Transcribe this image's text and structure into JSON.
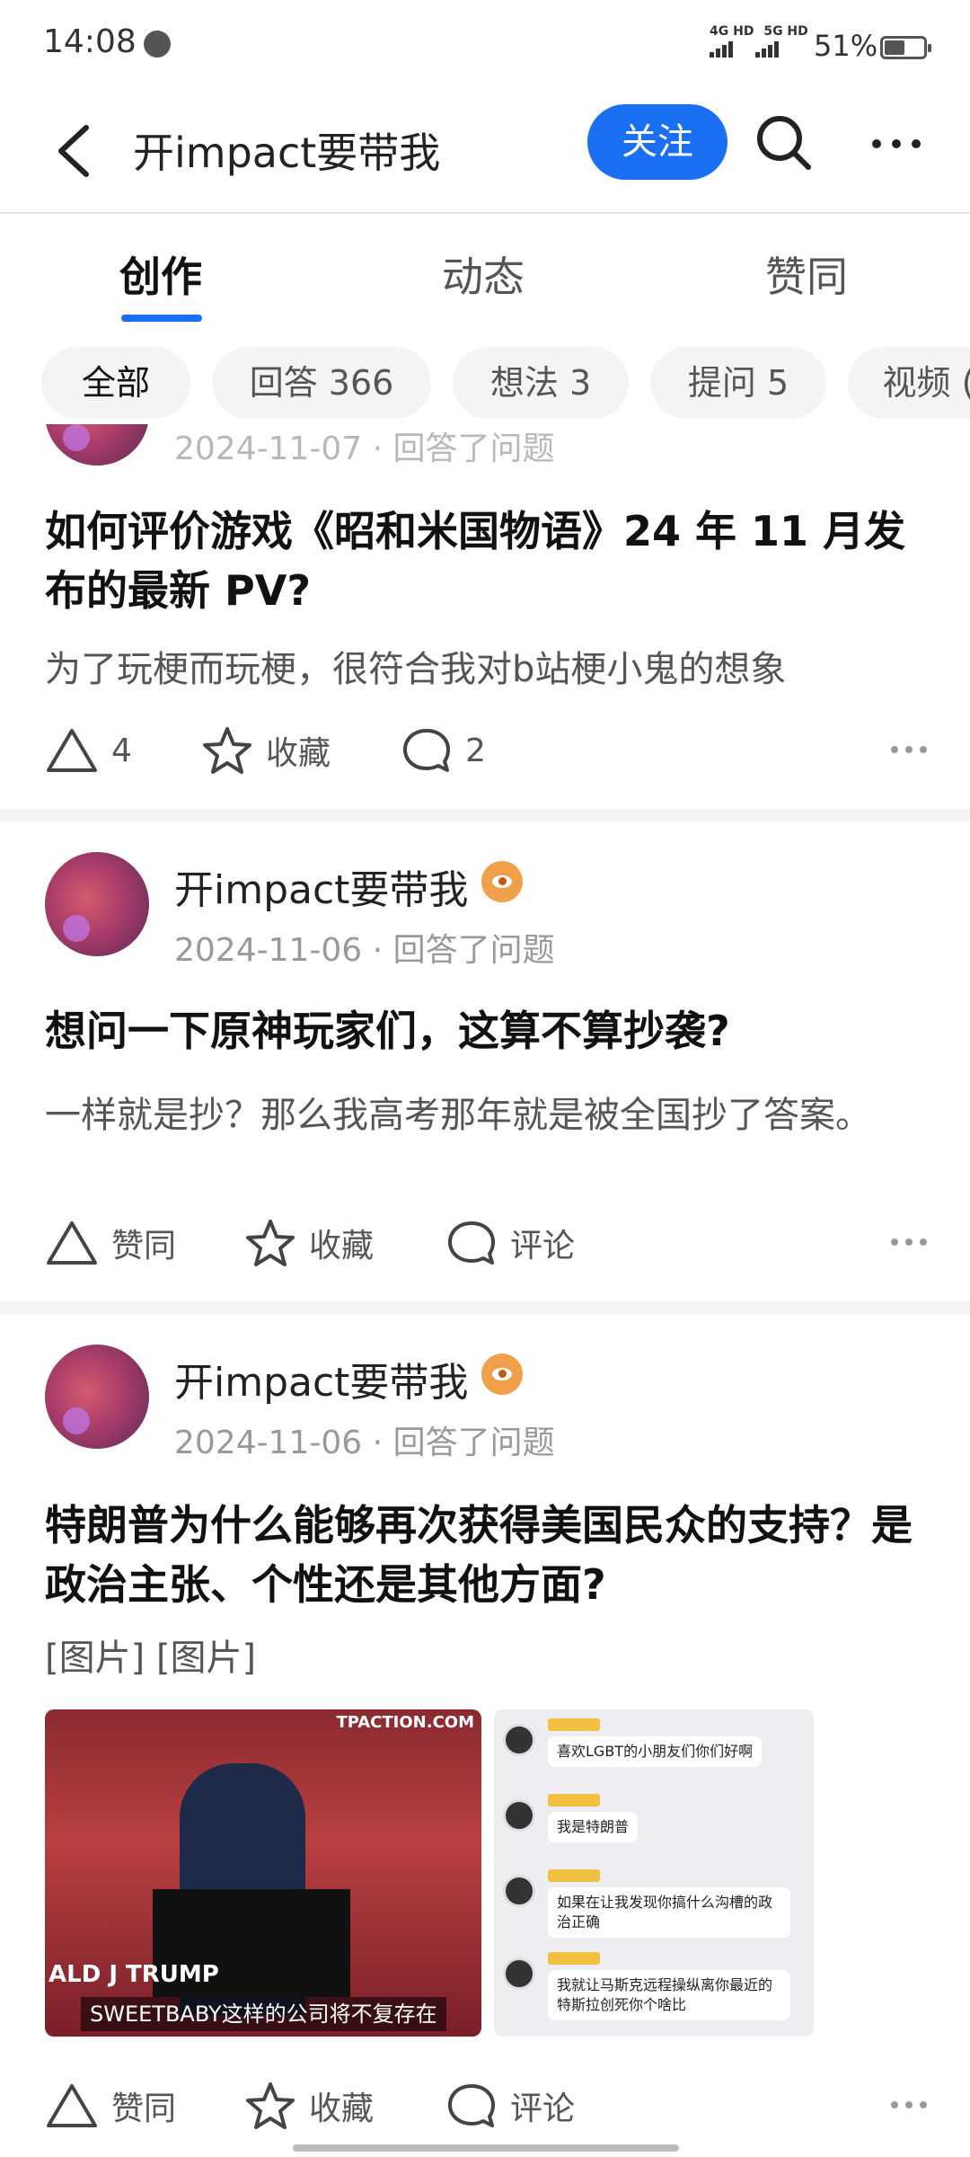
{
  "status_bar": {
    "time": "14:08",
    "network_1": "4G HD",
    "network_2": "5G HD",
    "battery": "51%"
  },
  "header": {
    "title": "开impact要带我",
    "follow_label": "关注",
    "icons": [
      "back-icon",
      "search-icon",
      "more-icon"
    ]
  },
  "tabs": [
    {
      "label": "创作",
      "active": true
    },
    {
      "label": "动态",
      "active": false
    },
    {
      "label": "赞同",
      "active": false
    }
  ],
  "chips": [
    {
      "label": "全部",
      "active": true
    },
    {
      "label": "回答 366"
    },
    {
      "label": "想法 3"
    },
    {
      "label": "提问 5"
    },
    {
      "label": "视频 (",
      "truncated": true
    }
  ],
  "feed": [
    {
      "partial_meta": "2024-11-07 · 回答了问题",
      "title": "如何评价游戏《昭和米国物语》24 年 11 月发布的最新 PV?",
      "excerpt": "为了玩梗而玩梗，很符合我对b站梗小鬼的想象",
      "actions": {
        "like": "4",
        "collect": "收藏",
        "comment": "2"
      }
    },
    {
      "author": "开impact要带我",
      "date": "2024-11-06",
      "action_text": "回答了问题",
      "title": "想问一下原神玩家们，这算不算抄袭?",
      "excerpt": "一样就是抄？那么我高考那年就是被全国抄了答案。",
      "actions": {
        "like": "赞同",
        "collect": "收藏",
        "comment": "评论"
      }
    },
    {
      "author": "开impact要带我",
      "date": "2024-11-06",
      "action_text": "回答了问题",
      "title": "特朗普为什么能够再次获得美国民众的支持？是政治主张、个性还是其他方面?",
      "excerpt": "[图片] [图片]",
      "images": {
        "img1_logo": "TPACTION.COM",
        "img1_name": "ALD J TRUMP",
        "img1_caption": "SWEETBABY这样的公司将不复存在",
        "img2_messages": [
          "喜欢LGBT的小朋友们你们好啊",
          "我是特朗普",
          "如果在让我发现你搞什么沟槽的政治正确",
          "我就让马斯克远程操纵离你最近的特斯拉创死你个啥比"
        ]
      },
      "actions": {
        "like": "赞同",
        "collect": "收藏",
        "comment": "评论"
      }
    }
  ]
}
